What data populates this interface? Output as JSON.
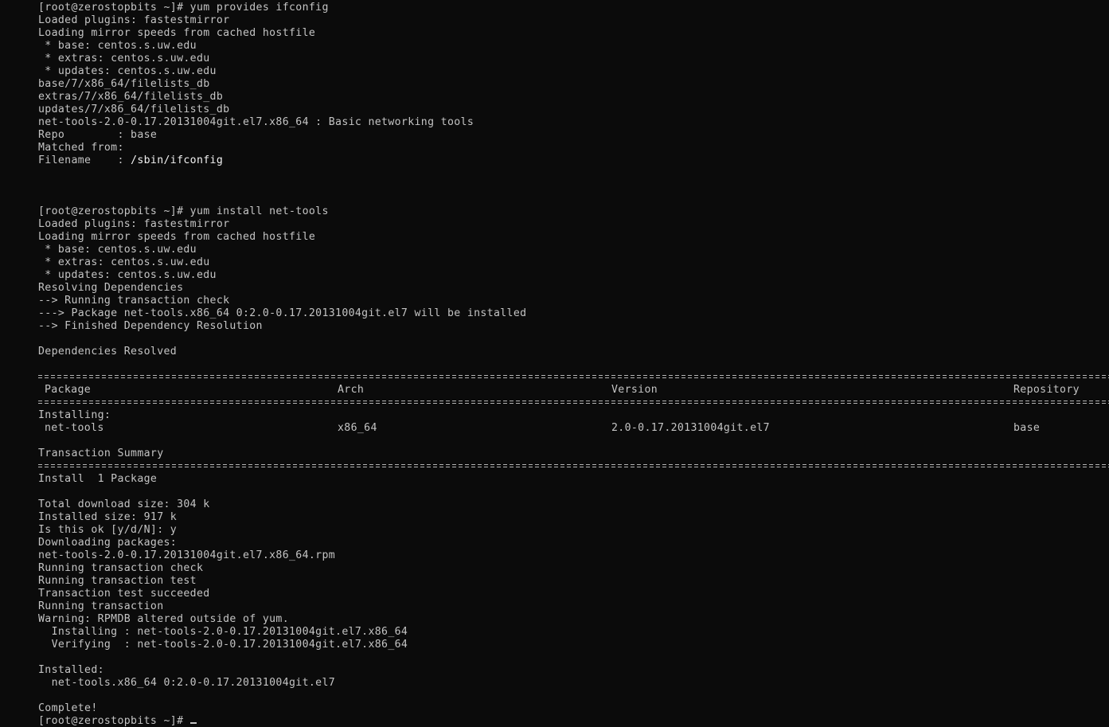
{
  "terminal": {
    "block1": [
      "[root@zerostopbits ~]# yum provides ifconfig",
      "Loaded plugins: fastestmirror",
      "Loading mirror speeds from cached hostfile",
      " * base: centos.s.uw.edu",
      " * extras: centos.s.uw.edu",
      " * updates: centos.s.uw.edu",
      "base/7/x86_64/filelists_db",
      "extras/7/x86_64/filelists_db",
      "updates/7/x86_64/filelists_db",
      "net-tools-2.0-0.17.20131004git.el7.x86_64 : Basic networking tools",
      "Repo        : base",
      "Matched from:"
    ],
    "filename_label": "Filename    : ",
    "filename_value": "/sbin/ifconfig",
    "block2": [
      "[root@zerostopbits ~]# yum install net-tools",
      "Loaded plugins: fastestmirror",
      "Loading mirror speeds from cached hostfile",
      " * base: centos.s.uw.edu",
      " * extras: centos.s.uw.edu",
      " * updates: centos.s.uw.edu",
      "Resolving Dependencies",
      "--> Running transaction check",
      "---> Package net-tools.x86_64 0:2.0-0.17.20131004git.el7 will be installed",
      "--> Finished Dependency Resolution"
    ],
    "deps_resolved": "Dependencies Resolved",
    "table": {
      "headers": {
        "package": "Package",
        "arch": "Arch",
        "version": "Version",
        "repository": "Repository"
      },
      "section": "Installing:",
      "row": {
        "package": "net-tools",
        "arch": "x86_64",
        "version": "2.0-0.17.20131004git.el7",
        "repository": "base"
      }
    },
    "summary_title": "Transaction Summary",
    "install_count": "Install  1 Package",
    "block3": [
      "Total download size: 304 k",
      "Installed size: 917 k",
      "Is this ok [y/d/N]: y",
      "Downloading packages:",
      "net-tools-2.0-0.17.20131004git.el7.x86_64.rpm",
      "Running transaction check",
      "Running transaction test",
      "Transaction test succeeded",
      "Running transaction",
      "Warning: RPMDB altered outside of yum.",
      "  Installing : net-tools-2.0-0.17.20131004git.el7.x86_64",
      "  Verifying  : net-tools-2.0-0.17.20131004git.el7.x86_64"
    ],
    "installed_label": "Installed:",
    "installed_pkg": "  net-tools.x86_64 0:2.0-0.17.20131004git.el7",
    "complete": "Complete!",
    "final_prompt": "[root@zerostopbits ~]# "
  }
}
